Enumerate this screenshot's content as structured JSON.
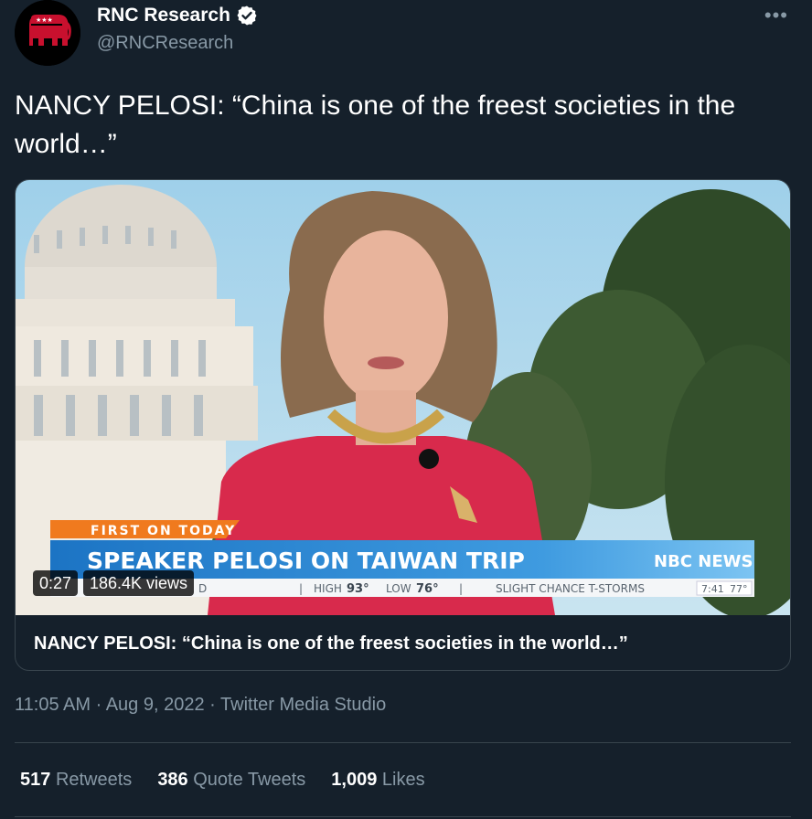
{
  "author": {
    "name": "RNC Research",
    "handle": "@RNCResearch"
  },
  "tweet": {
    "text": "NANCY PELOSI: “China is one of the freest societies in the world…”"
  },
  "video": {
    "duration": "0:27",
    "views": "186.4K views",
    "chyron": {
      "tag": "FIRST ON TODAY",
      "headline": "SPEAKER PELOSI ON TAIWAN TRIP",
      "network": "NBC NEWS",
      "high_label": "HIGH",
      "high": "93°",
      "low_label": "LOW",
      "low": "76°",
      "weather": "SLIGHT CHANCE T-STORMS",
      "clock": "7:41",
      "temp": "77°",
      "partial_left": "D"
    }
  },
  "card": {
    "title": "NANCY PELOSI: “China is one of the freest societies in the world…”"
  },
  "meta": {
    "time": "11:05 AM",
    "date": "Aug 9, 2022",
    "source": "Twitter Media Studio",
    "separator": "·"
  },
  "stats": {
    "retweets": {
      "count": "517",
      "label": "Retweets"
    },
    "quotes": {
      "count": "386",
      "label": "Quote Tweets"
    },
    "likes": {
      "count": "1,009",
      "label": "Likes"
    }
  },
  "colors": {
    "background": "#15202b",
    "secondary_text": "#8899a6",
    "border": "#38444d",
    "rnc_red": "#c8102e",
    "nbc_blue": "#1e88d6"
  }
}
